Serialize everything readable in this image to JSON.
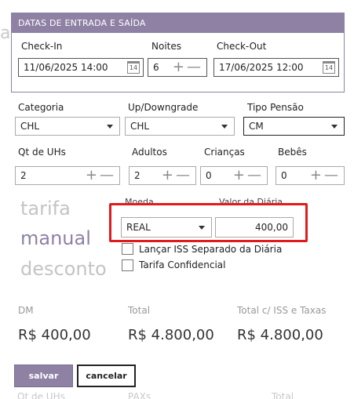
{
  "background": {
    "partial_letter": "a",
    "bottom_left": "Qt de UHs",
    "bottom_mid": "PAXs",
    "bottom_right": "Total"
  },
  "section": {
    "title": "DATAS DE ENTRADA E SAÍDA",
    "checkin_label": "Check-In",
    "checkin_value": "11/06/2025 14:00",
    "nights_label": "Noites",
    "nights_value": "6",
    "checkout_label": "Check-Out",
    "checkout_value": "17/06/2025 12:00",
    "calendar_icon_text": "14"
  },
  "fields": {
    "categoria_label": "Categoria",
    "categoria_value": "CHL",
    "updown_label": "Up/Downgrade",
    "updown_value": "CHL",
    "pensao_label": "Tipo Pensão",
    "pensao_value": "CM",
    "qtuhs_label": "Qt de UHs",
    "qtuhs_value": "2",
    "adultos_label": "Adultos",
    "adultos_value": "2",
    "criancas_label": "Crianças",
    "criancas_value": "0",
    "bebes_label": "Bebês",
    "bebes_value": "0"
  },
  "tariff_modes": {
    "tarifa": "tarifa",
    "manual": "manual",
    "desconto": "desconto"
  },
  "currency": {
    "moeda_label": "Moeda",
    "moeda_value": "REAL",
    "valor_label": "Valor da Diária",
    "valor_value": "400,00"
  },
  "checks": {
    "iss_label": "Lançar ISS Separado da Diária",
    "confidencial_label": "Tarifa Confidencial"
  },
  "totals": {
    "dm_label": "DM",
    "dm_value": "R$ 400,00",
    "total_label": "Total",
    "total_value": "R$ 4.800,00",
    "total_iss_label": "Total c/ ISS e Taxas",
    "total_iss_value": "R$ 4.800,00"
  },
  "buttons": {
    "save": "salvar",
    "cancel": "cancelar"
  },
  "colors": {
    "accent": "#8e81a4",
    "highlight": "#e01b1b"
  }
}
